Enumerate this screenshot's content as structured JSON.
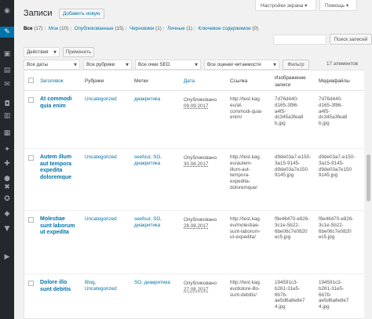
{
  "sidebar": {
    "icons": [
      "dashboard-icon",
      "pin-icon",
      "media-icon",
      "pages-icon",
      "comments-icon",
      "woo-icon",
      "products-icon",
      "chart-icon",
      "appearance-icon",
      "plugins-icon",
      "users-icon",
      "tools-icon",
      "settings-icon",
      "seo-icon",
      "filter-icon",
      "play-icon"
    ]
  },
  "topbar": {
    "screen_options": "Настройки экрана ▾",
    "help": "Помощь ▾"
  },
  "header": {
    "title": "Записи",
    "add_new": "Добавить новую"
  },
  "filters": {
    "all": "Все",
    "all_count": "(17)",
    "mine": "Мои",
    "mine_count": "(10)",
    "published": "Опубликованные",
    "published_count": "(15)",
    "drafts": "Черновики",
    "drafts_count": "(1)",
    "private": "Личные",
    "private_count": "(1)",
    "cornerstone": "Ключевое содержимое",
    "cornerstone_count": "(0)"
  },
  "search": {
    "placeholder": "",
    "button": "Поиск записей"
  },
  "bulk": {
    "action": "Действия",
    "apply": "Применить"
  },
  "dropdowns": {
    "dates": "Все даты",
    "categories": "Все рубрики",
    "seo": "Все очки SEO",
    "readability": "Все оценки читаемости",
    "filter_btn": "Фильтр"
  },
  "item_count": "17 элементов",
  "columns": {
    "title": "Заголовок",
    "categories": "Рубрики",
    "tags": "Метки",
    "date": "Дата",
    "link": "Ссылка",
    "image_line1": "Изображение",
    "image_line2": "записи",
    "media": "Медиафайлы"
  },
  "rows": [
    {
      "title": [
        "At commodi",
        "quia enim"
      ],
      "category": [
        "Uncategorized"
      ],
      "tags": [
        "диакритика"
      ],
      "status": "Опубликовано",
      "date": "09.09.2017",
      "link": [
        "http://test.kag.",
        "eu/at-",
        "commodi-quia-",
        "enim/"
      ],
      "image": [
        "7d76d440-",
        "d165-3f86-",
        "a4f5-",
        "dc345a3fea8",
        "b.jpg"
      ],
      "media": [
        "7d76d440-",
        "d165-3f86-",
        "a4f5-",
        "dc345a3fea8",
        "b.jpg"
      ]
    },
    {
      "title": [
        "Autem illum",
        "aut tempora",
        "expedita",
        "doloremque"
      ],
      "category": [
        "Uncategorized"
      ],
      "tags": [
        "seefour, SO,",
        "диакритика"
      ],
      "status": "Опубликовано",
      "date": "30.08.2017",
      "link": [
        "http://test.kag.",
        "eu/autem-",
        "illum-aut-",
        "tempora-",
        "expedita-",
        "doloremque/"
      ],
      "image": [
        "d9de03a7-e150-",
        "3a15-9145-",
        "d9de03a7e150",
        "9145.jpg"
      ],
      "media": [
        "d9de03a7-e150-",
        "3a15-9145-",
        "d9de03a7e150",
        "9145.jpg"
      ]
    },
    {
      "title": [
        "Molestiae",
        "sunt laborum",
        "ut expedita"
      ],
      "category": [
        "Uncategorized"
      ],
      "tags": [
        "seefour, SO,",
        "диакритика"
      ],
      "status": "Опубликовано",
      "date": "28.08.2017",
      "link": [
        "http://test.kag.",
        "eu/molestiae-",
        "sunt-laborum-",
        "ut-expedita/"
      ],
      "image": [
        "f9e46470-e826-",
        "3c1e-5b22-",
        "6be06c7e0820",
        "ec5.jpg"
      ],
      "media": [
        "f9e46470-e826-",
        "3c1e-5b22-",
        "6be06c7e0820",
        "ec5.jpg"
      ]
    },
    {
      "title": [
        "Dolore illo",
        "sunt debitis"
      ],
      "category": [
        "Blog,",
        "Uncategorized"
      ],
      "tags": [
        "SO, диакритика"
      ],
      "status": "Опубликовано",
      "date": "27.08.2017",
      "link": [
        "http://test.kag.",
        "eu/dolore-illo-",
        "sunt-debitis/"
      ],
      "image": [
        "194591c3-",
        "b261-31e5-",
        "6b7b-",
        "ae5d6a8e8e7",
        "4.jpg"
      ],
      "media": [
        "194591c3-",
        "b261-31e5-",
        "6b7b-",
        "ae5d6a8e8e7",
        "4.jpg"
      ]
    }
  ]
}
